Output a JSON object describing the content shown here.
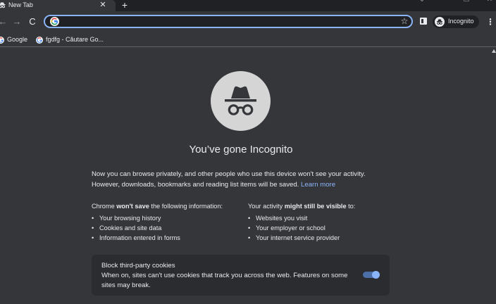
{
  "tab": {
    "title": "New Tab",
    "close_icon": "close-icon"
  },
  "toolbar": {
    "back_icon": "back-arrow-icon",
    "forward_icon": "forward-arrow-icon",
    "reload_icon": "reload-icon",
    "omnibox_value": "",
    "star_icon": "star-icon",
    "incognito_label": "Incognito",
    "menu_icon": "three-dot-menu-icon"
  },
  "bookmarks": [
    {
      "label": "Google"
    },
    {
      "label": "fgdfg - Căutare Go..."
    }
  ],
  "content": {
    "heading": "You’ve gone Incognito",
    "intro_line1": "Now you can browse privately, and other people who use this device won't see your activity.",
    "intro_line2": "However, downloads, bookmarks and reading list items will be saved.",
    "learn_more": "Learn more",
    "left_col": {
      "heading_pre": "Chrome ",
      "heading_bold": "won't save",
      "heading_post": " the following information:",
      "items": [
        "Your browsing history",
        "Cookies and site data",
        "Information entered in forms"
      ]
    },
    "right_col": {
      "heading_pre": "Your activity ",
      "heading_bold": "might still be visible",
      "heading_post": " to:",
      "items": [
        "Websites you visit",
        "Your employer or school",
        "Your internet service provider"
      ]
    },
    "cookies": {
      "title": "Block third-party cookies",
      "description": "When on, sites can't use cookies that track you across the web. Features on some sites may break.",
      "enabled": true
    }
  },
  "colors": {
    "background": "#35363a",
    "accent": "#8ab4f8",
    "frame": "#202124",
    "card": "#2b2c2f"
  }
}
